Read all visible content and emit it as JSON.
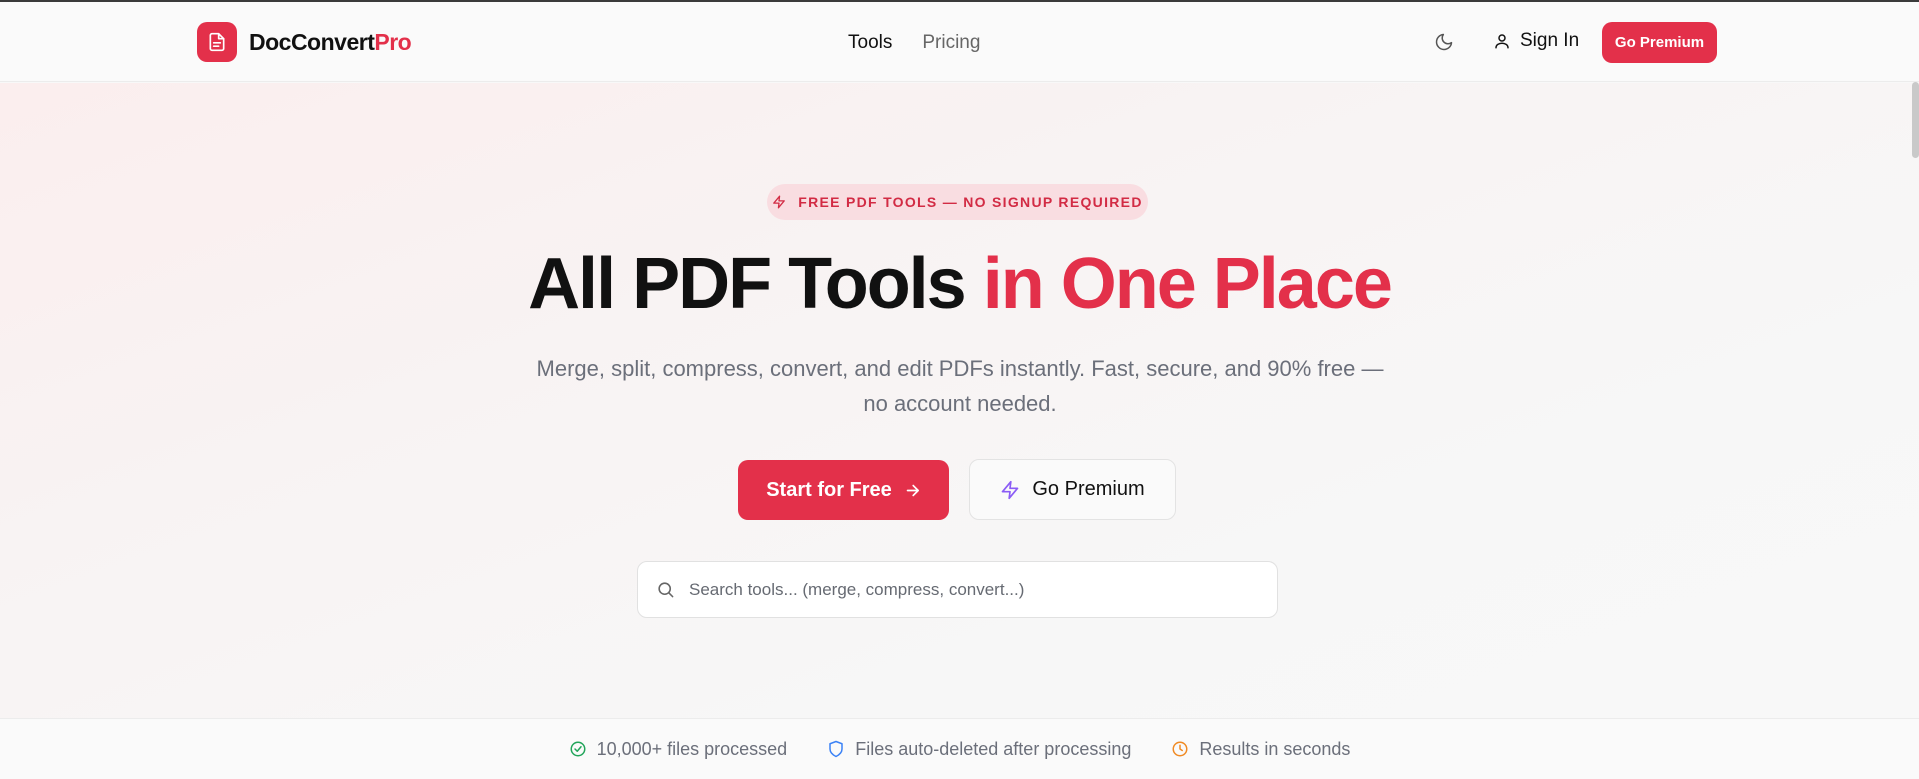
{
  "header": {
    "logo": {
      "name": "DocConvert",
      "suffix": "Pro",
      "icon": "document-icon"
    },
    "nav": [
      {
        "label": "Tools",
        "active": true
      },
      {
        "label": "Pricing",
        "active": false
      }
    ],
    "theme_toggle_icon": "moon-icon",
    "sign_in_label": "Sign In",
    "premium_label": "Go Premium"
  },
  "hero": {
    "badge": "FREE PDF TOOLS — NO SIGNUP REQUIRED",
    "title_main": "All PDF Tools",
    "title_accent": "in One Place",
    "subtitle": "Merge, split, compress, convert, and edit PDFs instantly. Fast, secure, and 90% free — no account needed.",
    "cta_primary": "Start for Free",
    "cta_secondary": "Go Premium",
    "search_placeholder": "Search tools... (merge, compress, convert...)"
  },
  "stats": [
    {
      "label": "10,000+ files processed",
      "icon": "check-circle-icon",
      "color": "#22a55a"
    },
    {
      "label": "Files auto-deleted after processing",
      "icon": "shield-icon",
      "color": "#3b82f6"
    },
    {
      "label": "Results in seconds",
      "icon": "clock-icon",
      "color": "#f08a24"
    }
  ],
  "colors": {
    "accent": "#e3304a",
    "badge_bg": "#f9dde1",
    "premium_icon": "#8b5cf6"
  }
}
